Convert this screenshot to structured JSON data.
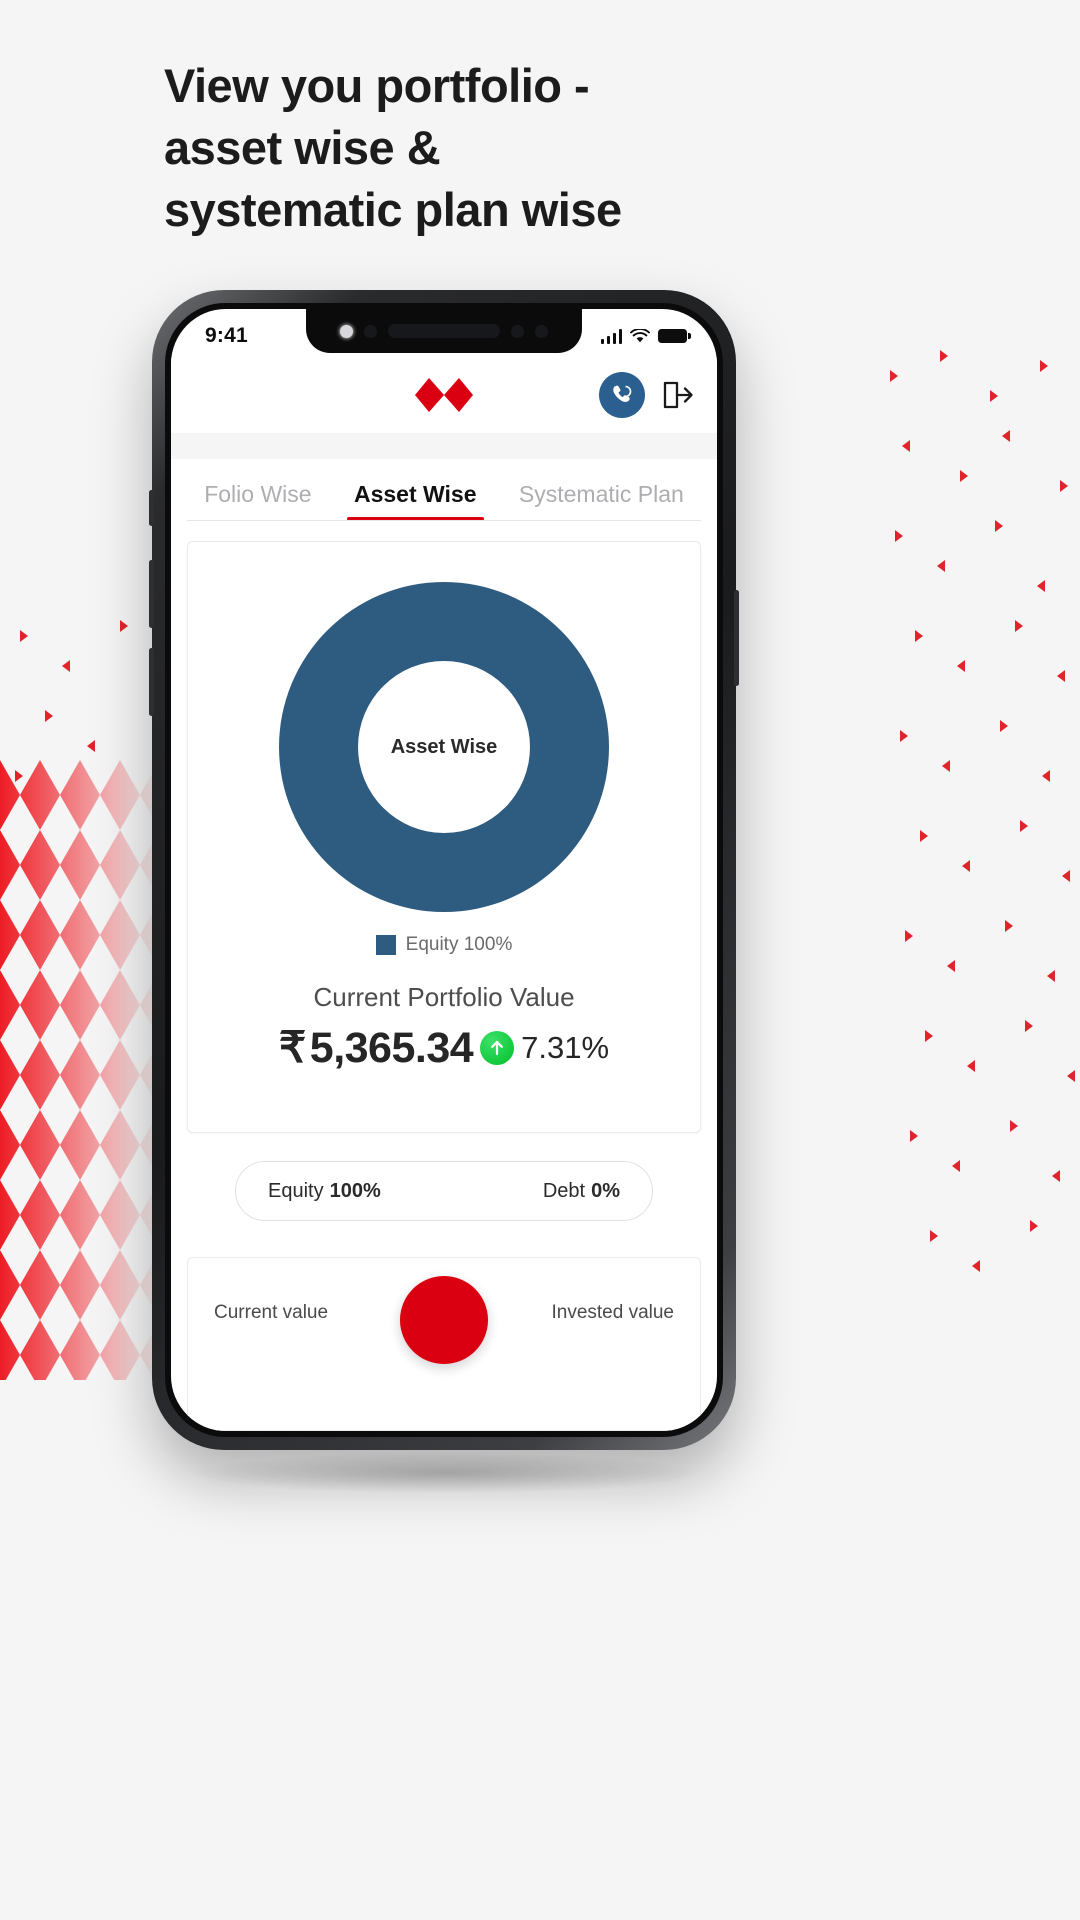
{
  "headline": {
    "line1": "View you portfolio -",
    "line2": "asset wise &",
    "line3": "systematic plan wise"
  },
  "phone": {
    "status_bar": {
      "time": "9:41",
      "signal_icon": "cellular-signal-icon",
      "wifi_icon": "wifi-icon",
      "battery_icon": "battery-full-icon"
    },
    "app_header": {
      "logo": "hsbc-hexagon-logo",
      "call_icon": "phone-support-icon",
      "logout_icon": "logout-icon"
    },
    "tabs": [
      {
        "label": "Folio Wise",
        "active": false
      },
      {
        "label": "Asset Wise",
        "active": true
      },
      {
        "label": "Systematic Plan",
        "active": false
      }
    ],
    "chart_card": {
      "donut_center_label": "Asset Wise",
      "legend": [
        {
          "label": "Equity 100%",
          "color": "#2e5b80"
        }
      ],
      "portfolio_label": "Current Portfolio Value",
      "currency_symbol": "₹",
      "portfolio_value": "5,365.34",
      "change_icon": "arrow-up-circle-icon",
      "change_percent": "7.31%"
    },
    "allocation_pill": {
      "equity_label": "Equity",
      "equity_value": "100%",
      "debt_label": "Debt",
      "debt_value": "0%"
    },
    "bottom_card": {
      "left_label": "Current value",
      "right_label": "Invested value"
    }
  },
  "colors": {
    "brand_red": "#db0011",
    "chart_blue": "#2e5b80",
    "positive_green": "#12c93b",
    "page_bg": "#f5f5f5"
  },
  "chart_data": {
    "type": "pie",
    "title": "Asset Wise",
    "labels": [
      "Equity",
      "Debt"
    ],
    "values": [
      100,
      0
    ],
    "display_labels": [
      "Equity 100%"
    ],
    "colors": [
      "#2e5b80"
    ],
    "donut": true,
    "legend_position": "bottom",
    "center_text": "Asset Wise",
    "annotations": {
      "portfolio_label": "Current Portfolio Value",
      "portfolio_value": "₹ 5,365.34",
      "change_percent": "7.31%",
      "change_direction": "up"
    }
  }
}
